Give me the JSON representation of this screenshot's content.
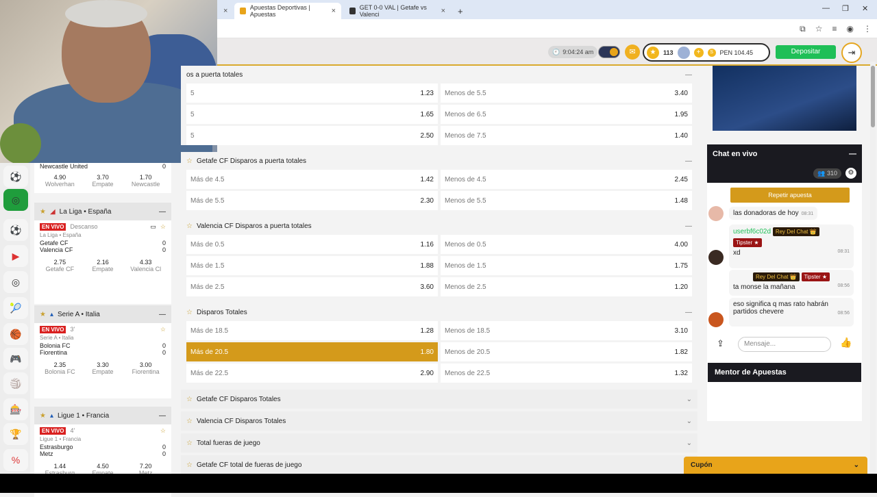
{
  "browser": {
    "tabs": [
      {
        "label": "Apuestas Deportivas | Apuestas",
        "active": true
      },
      {
        "label": "GET 0-0 VAL | Getafe vs Valenci",
        "active": false
      }
    ],
    "new_tab": "+",
    "close": "×"
  },
  "topbar": {
    "time": "9:04:24 am",
    "level": "113",
    "balance": "PEN 104.45",
    "deposit_label": "Depositar"
  },
  "sidebar": {
    "top_match": {
      "team2": "Newcastle United",
      "score2": "0",
      "odds": [
        {
          "value": "4.90",
          "label": "Wolverhan"
        },
        {
          "value": "3.70",
          "label": "Empate"
        },
        {
          "value": "1.70",
          "label": "Newcastle"
        }
      ]
    },
    "leagues": [
      {
        "name": "La Liga • España",
        "match": {
          "live": "EN VIVO",
          "status": "Descanso",
          "league": "La Liga • España",
          "team1": "Getafe CF",
          "score1": "0",
          "team2": "Valencia CF",
          "score2": "0",
          "odds": [
            {
              "value": "2.75",
              "label": "Getafe CF"
            },
            {
              "value": "2.16",
              "label": "Empate"
            },
            {
              "value": "4.33",
              "label": "Valencia Cl"
            }
          ]
        }
      },
      {
        "name": "Serie A • Italia",
        "match": {
          "live": "EN VIVO",
          "status": "3'",
          "league": "Serie A • Italia",
          "team1": "Bolonia FC",
          "score1": "0",
          "team2": "Fiorentina",
          "score2": "0",
          "odds": [
            {
              "value": "2.35",
              "label": "Bolonia FC"
            },
            {
              "value": "3.30",
              "label": "Empate"
            },
            {
              "value": "3.00",
              "label": "Fiorentina"
            }
          ]
        }
      },
      {
        "name": "Ligue 1 • Francia",
        "match": {
          "live": "EN VIVO",
          "status": "4'",
          "league": "Ligue 1 • Francia",
          "team1": "Estrasburgo",
          "score1": "0",
          "team2": "Metz",
          "score2": "0",
          "odds": [
            {
              "value": "1.44",
              "label": "Estrasburg"
            },
            {
              "value": "4.50",
              "label": "Empate"
            },
            {
              "value": "7.20",
              "label": "Metz"
            }
          ]
        }
      }
    ]
  },
  "markets": [
    {
      "title": "os a puerta totales",
      "rows": [
        [
          {
            "label": "5",
            "value": "1.23"
          },
          {
            "label": "Menos de 5.5",
            "value": "3.40"
          }
        ],
        [
          {
            "label": "5",
            "value": "1.65"
          },
          {
            "label": "Menos de 6.5",
            "value": "1.95"
          }
        ],
        [
          {
            "label": "5",
            "value": "2.50"
          },
          {
            "label": "Menos de 7.5",
            "value": "1.40"
          }
        ]
      ]
    },
    {
      "title": "Getafe CF Disparos a puerta totales",
      "rows": [
        [
          {
            "label": "Más de 4.5",
            "value": "1.42"
          },
          {
            "label": "Menos de 4.5",
            "value": "2.45"
          }
        ],
        [
          {
            "label": "Más de 5.5",
            "value": "2.30"
          },
          {
            "label": "Menos de 5.5",
            "value": "1.48"
          }
        ]
      ]
    },
    {
      "title": "Valencia CF Disparos a puerta totales",
      "rows": [
        [
          {
            "label": "Más de 0.5",
            "value": "1.16"
          },
          {
            "label": "Menos de 0.5",
            "value": "4.00"
          }
        ],
        [
          {
            "label": "Más de 1.5",
            "value": "1.88"
          },
          {
            "label": "Menos de 1.5",
            "value": "1.75"
          }
        ],
        [
          {
            "label": "Más de 2.5",
            "value": "3.60"
          },
          {
            "label": "Menos de 2.5",
            "value": "1.20"
          }
        ]
      ]
    },
    {
      "title": "Disparos Totales",
      "rows": [
        [
          {
            "label": "Más de 18.5",
            "value": "1.28"
          },
          {
            "label": "Menos de 18.5",
            "value": "3.10"
          }
        ],
        [
          {
            "label": "Más de 20.5",
            "value": "1.80",
            "selected": true
          },
          {
            "label": "Menos de 20.5",
            "value": "1.82"
          }
        ],
        [
          {
            "label": "Más de 22.5",
            "value": "2.90"
          },
          {
            "label": "Menos de 22.5",
            "value": "1.32"
          }
        ]
      ]
    }
  ],
  "collapsed_markets": [
    "Getafe CF Disparos Totales",
    "Valencia CF Disparos Totales",
    "Total fueras de juego",
    "Getafe CF total de fueras de juego"
  ],
  "chat": {
    "title": "Chat en vivo",
    "count": "310",
    "repeat_label": "Repetir apuesta",
    "messages": [
      {
        "text": "las donadoras de hoy",
        "time": "08:31"
      },
      {
        "user": "userbf6c02d",
        "badge1": "Rey Del Chat 👑",
        "badge2": "Tipster ★",
        "text": "xd",
        "time": "08:31"
      },
      {
        "badge1": "Rey Del Chat 👑",
        "badge2": "Tipster ★",
        "text": "ta monse la mañana",
        "time": "08:56"
      },
      {
        "text": "eso significa q mas rato habrán partidos chevere",
        "time": "08:56"
      }
    ],
    "placeholder": "Mensaje..."
  },
  "mentor_title": "Mentor de Apuestas",
  "cupon_label": "Cupón"
}
